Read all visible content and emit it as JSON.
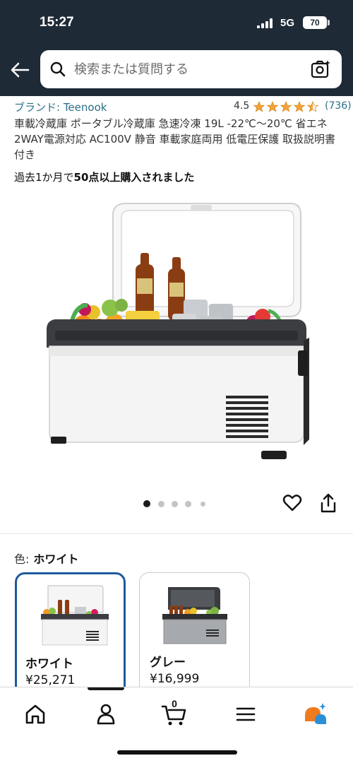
{
  "status": {
    "time": "15:27",
    "network": "5G",
    "battery": "70"
  },
  "header": {
    "search_placeholder": "検索または質問する",
    "icons": [
      "back-arrow-icon",
      "search-icon",
      "camera-search-icon"
    ]
  },
  "product": {
    "brand": "ブランド: Teenook",
    "rating": "4.5",
    "rating_stars": 4.5,
    "rating_count": "(736)",
    "title": "車載冷蔵庫 ポータブル冷蔵庫 急速冷凍 19L -22℃～20℃ 省エネ 2WAY電源対応 AC100V 静音 車載家庭両用 低電圧保護 取扱説明書付き",
    "purchase_prefix": "過去1か月で",
    "purchase_bold": "50点以上購入されました",
    "image_count": 5,
    "image_active_index": 0
  },
  "color": {
    "label": "色:",
    "selected": "ホワイト",
    "options": [
      {
        "name": "ホワイト",
        "price": "¥25,271"
      },
      {
        "name": "グレー",
        "price": "¥16,999"
      }
    ]
  },
  "bottom_nav": {
    "cart_count": "0",
    "items": [
      "home-icon",
      "account-icon",
      "cart-icon",
      "menu-icon",
      "rufus-ai-icon"
    ]
  },
  "colors": {
    "header_bg": "#1f2a37",
    "link": "#2a6f87",
    "star": "#f2a33a",
    "selected_border": "#1e5a9c"
  }
}
